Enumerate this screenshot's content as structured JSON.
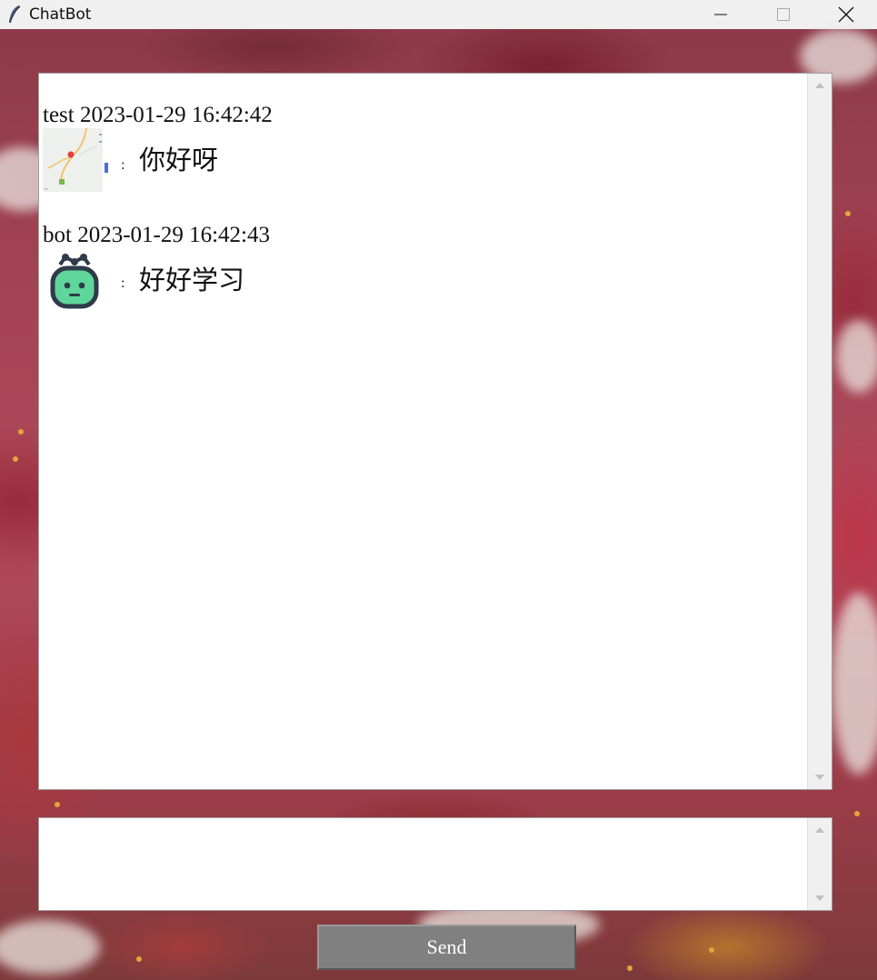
{
  "window": {
    "title": "ChatBot",
    "icon": "feather-icon",
    "controls": [
      "minimize-icon",
      "maximize-icon",
      "close-icon"
    ]
  },
  "chat": {
    "messages": [
      {
        "sender": "test",
        "timestamp": "2023-01-29 16:42:42",
        "header": "test 2023-01-29 16:42:42",
        "avatar": "map-thumbnail",
        "separator": ":",
        "text": "你好呀"
      },
      {
        "sender": "bot",
        "timestamp": "2023-01-29 16:42:43",
        "header": "bot 2023-01-29 16:42:43",
        "avatar": "robot-icon",
        "separator": ":",
        "text": "好好学习"
      }
    ]
  },
  "input": {
    "value": ""
  },
  "send_button": {
    "label": "Send"
  },
  "colors": {
    "titlebar": "#f0f0f0",
    "bot_avatar_face": "#5fd69a",
    "bot_avatar_outline": "#2f3a4a",
    "send_button_bg": "#808080"
  }
}
